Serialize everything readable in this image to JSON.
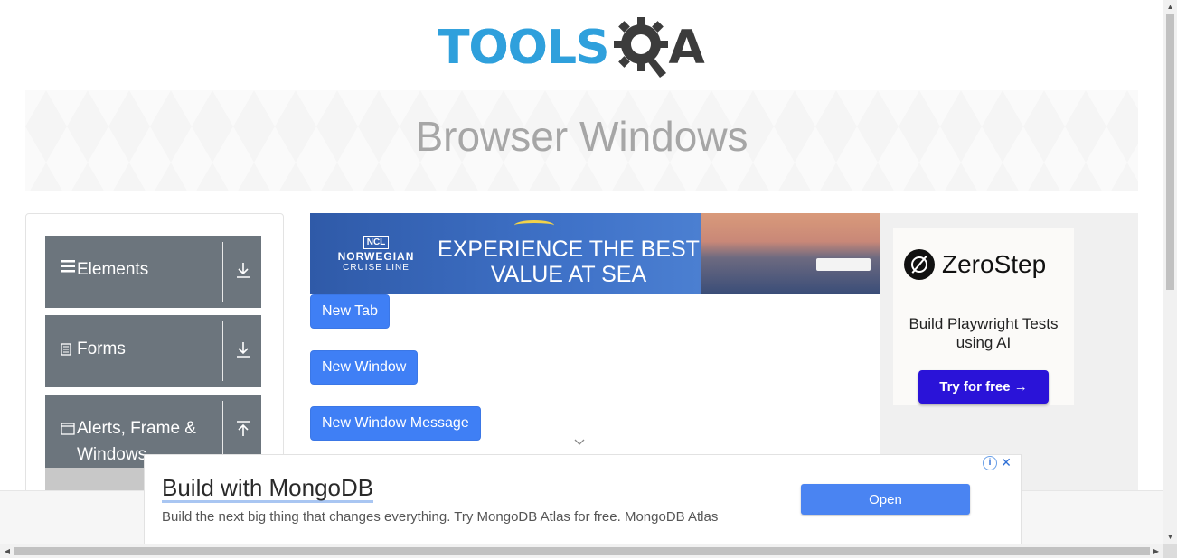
{
  "header": {
    "logo_text": "TOOLS",
    "logo_q": "Q",
    "logo_a": "A",
    "logo_alt": "TOOLSQA"
  },
  "banner": {
    "title": "Browser Windows"
  },
  "menu": {
    "groups": [
      {
        "label": "Elements",
        "icon": "hamburger-icon",
        "arrow": "⤓"
      },
      {
        "label": "Forms",
        "icon": "document-icon",
        "arrow": "⤓"
      },
      {
        "label": "Alerts, Frame & Windows",
        "icon": "window-icon",
        "arrow": "⤒"
      }
    ]
  },
  "ad_top": {
    "brand_badge": "NCL",
    "brand_name": "NORWEGIAN",
    "brand_sub": "CRUISE LINE",
    "headline": "EXPERIENCE THE BEST VALUE AT SEA"
  },
  "buttons": {
    "new_tab": "New Tab",
    "new_window": "New Window",
    "new_window_message": "New Window Message"
  },
  "ad_right": {
    "brand": "ZeroStep",
    "tagline": "Build Playwright Tests using AI",
    "cta": "Try for free →"
  },
  "ad_bottom": {
    "title": "Build with MongoDB",
    "description": "Build the next big thing that changes everything. Try MongoDB Atlas for free. MongoDB Atlas",
    "cta": "Open",
    "info": "i",
    "close": "✕"
  },
  "colors": {
    "primary_button": "#3f7ff5",
    "menu_header": "#6c757d",
    "logo_blue": "#2fa0dc",
    "logo_dark": "#3c3c3c",
    "zerostep_button": "#2a13d8"
  }
}
